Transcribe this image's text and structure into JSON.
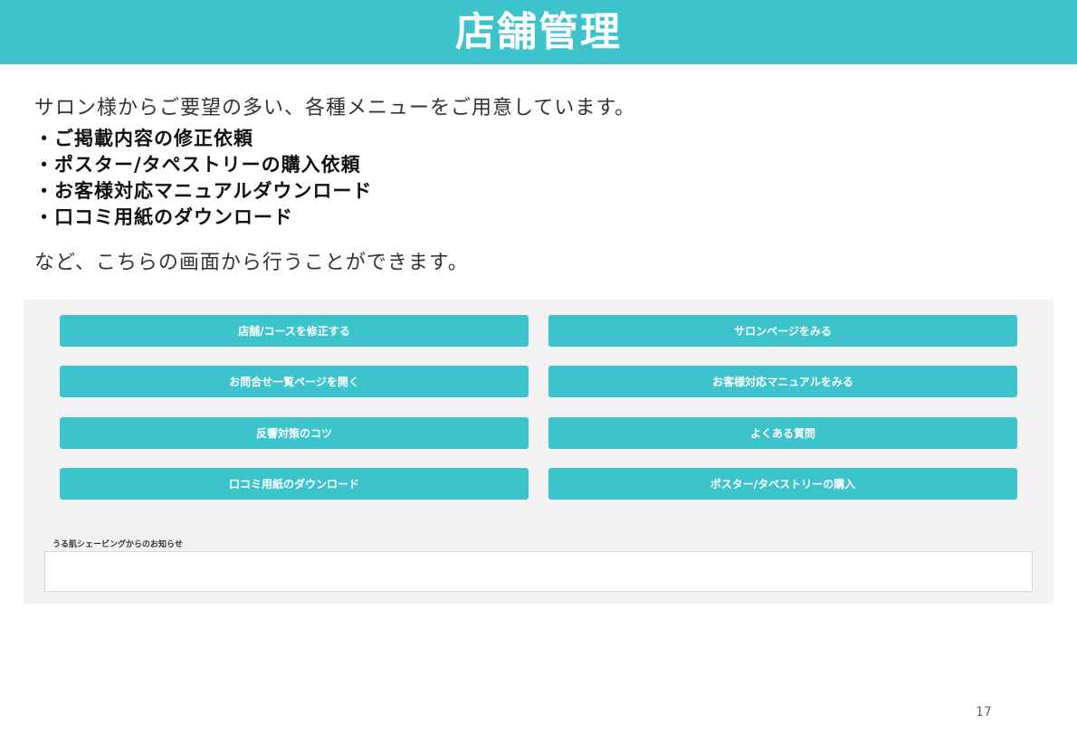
{
  "header": {
    "title": "店舗管理"
  },
  "intro": "サロン様からご要望の多い、各種メニューをご用意しています。",
  "bullets": [
    "・ご掲載内容の修正依頼",
    "・ポスター/タペストリーの購入依頼",
    "・お客様対応マニュアルダウンロード",
    "・口コミ用紙のダウンロード"
  ],
  "outro": "など、こちらの画面から行うことができます。",
  "panel": {
    "buttons": {
      "edit_store": "店舗/コースを修正する",
      "view_salon": "サロンページをみる",
      "inquiries": "お問合せ一覧ページを開く",
      "manual": "お客様対応マニュアルをみる",
      "response_tips": "反響対策のコツ",
      "faq": "よくある質問",
      "review_form": "口コミ用紙のダウンロード",
      "poster": "ポスター/タペストリーの購入"
    },
    "notice_label": "うる肌シェービングからのお知らせ",
    "notice_text": ""
  },
  "page_number": "17",
  "colors": {
    "accent": "#3cc3cc",
    "panel_bg": "#f2f2f2"
  }
}
